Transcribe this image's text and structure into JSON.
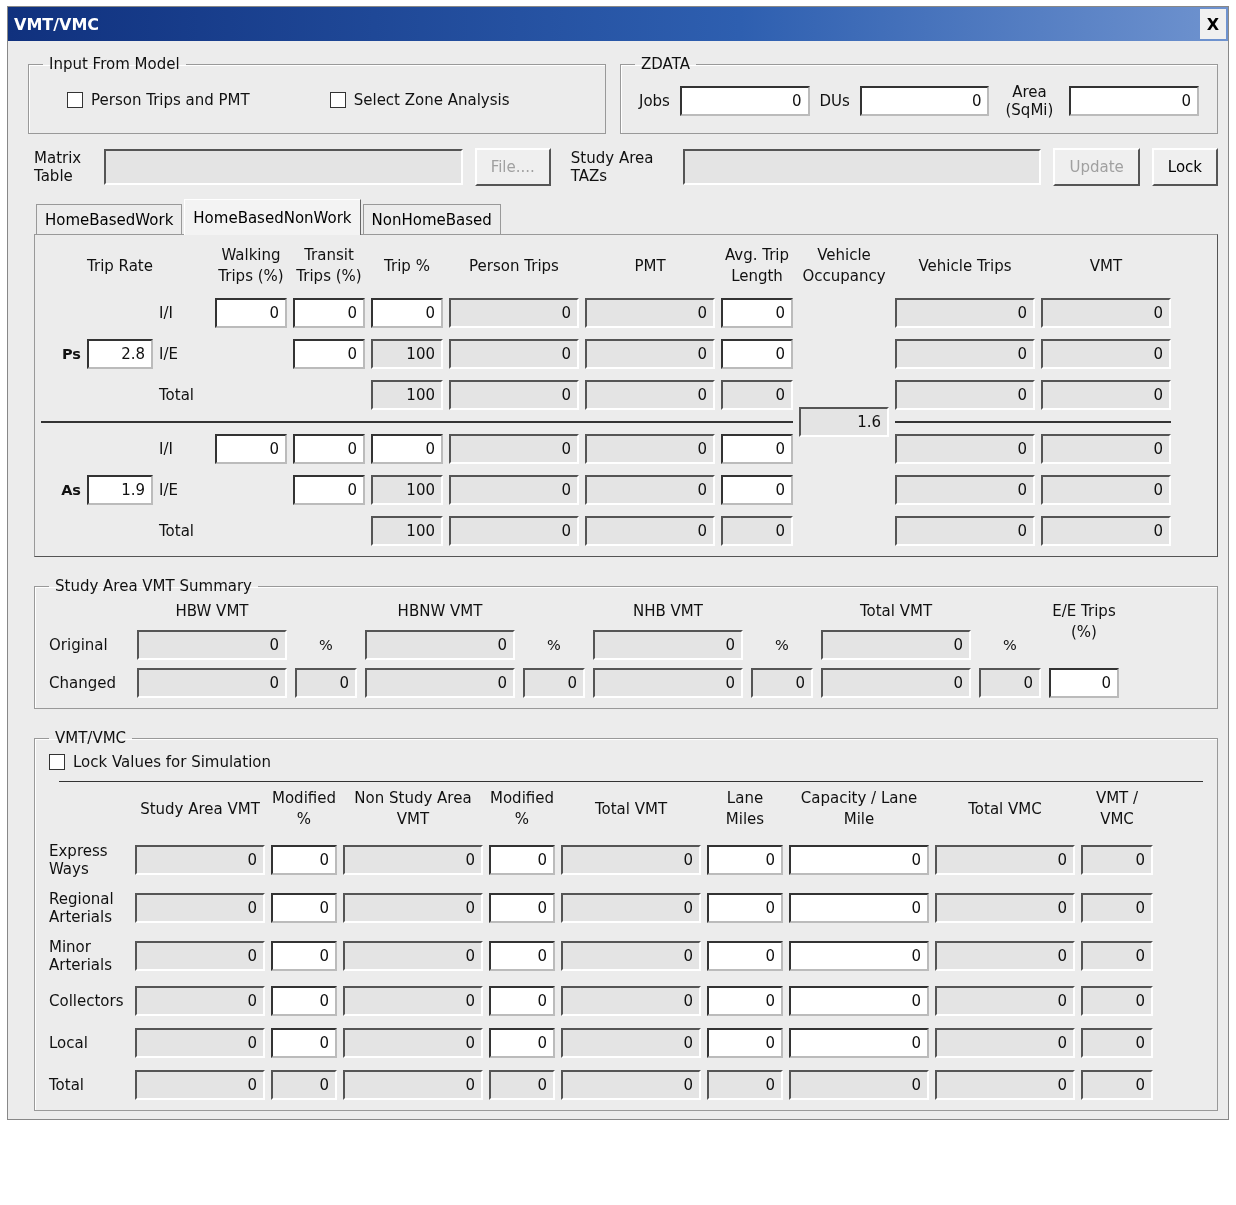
{
  "window": {
    "title": "VMT/VMC",
    "close": "X"
  },
  "input_from_model": {
    "title": "Input From Model",
    "checkboxes": [
      {
        "label": "Person Trips and PMT",
        "checked": false
      },
      {
        "label": "Select Zone Analysis",
        "checked": false
      }
    ]
  },
  "zdata": {
    "title": "ZDATA",
    "fields": [
      {
        "label": "Jobs",
        "value": "0"
      },
      {
        "label": "DUs",
        "value": "0"
      },
      {
        "label": "Area (SqMi)",
        "value": "0"
      }
    ]
  },
  "matrix": {
    "label": "Matrix Table",
    "button": {
      "label": "File....",
      "disabled": true
    }
  },
  "study_area": {
    "label": "Study Area TAZs",
    "buttons": [
      {
        "label": "Update",
        "disabled": true
      },
      {
        "label": "Lock",
        "disabled": false
      }
    ]
  },
  "tabs": [
    {
      "label": "HomeBasedWork",
      "selected": false
    },
    {
      "label": "HomeBasedNonWork",
      "selected": true
    },
    {
      "label": "NonHomeBased",
      "selected": false
    }
  ],
  "trips": {
    "columns": [
      "Trip Rate",
      "Walking Trips (%)",
      "Transit Trips (%)",
      "Trip %",
      "Person Trips",
      "PMT",
      "Avg. Trip Length",
      "Vehicle Occupancy",
      "Vehicle Trips",
      "VMT"
    ],
    "vehicle_occupancy": "1.6",
    "groups": [
      {
        "label": "Ps",
        "rate": "2.8",
        "rows": [
          {
            "label": "I/I",
            "cells": [
              {
                "kind": "input",
                "value": "0"
              },
              {
                "kind": "input",
                "value": "0"
              },
              {
                "kind": "input",
                "value": "0"
              },
              {
                "kind": "readonly",
                "value": "0"
              },
              {
                "kind": "readonly",
                "value": "0"
              },
              {
                "kind": "input",
                "value": "0"
              },
              {
                "kind": "readonly",
                "value": "0"
              },
              {
                "kind": "readonly",
                "value": "0"
              }
            ]
          },
          {
            "label": "I/E",
            "cells": [
              {
                "kind": "none"
              },
              {
                "kind": "input",
                "value": "0"
              },
              {
                "kind": "readonly",
                "value": "100"
              },
              {
                "kind": "readonly",
                "value": "0"
              },
              {
                "kind": "readonly",
                "value": "0"
              },
              {
                "kind": "input",
                "value": "0"
              },
              {
                "kind": "readonly",
                "value": "0"
              },
              {
                "kind": "readonly",
                "value": "0"
              }
            ]
          },
          {
            "label": "Total",
            "cells": [
              {
                "kind": "none"
              },
              {
                "kind": "none"
              },
              {
                "kind": "readonly",
                "value": "100"
              },
              {
                "kind": "readonly",
                "value": "0"
              },
              {
                "kind": "readonly",
                "value": "0"
              },
              {
                "kind": "readonly",
                "value": "0"
              },
              {
                "kind": "readonly",
                "value": "0"
              },
              {
                "kind": "readonly",
                "value": "0"
              }
            ]
          }
        ]
      },
      {
        "label": "As",
        "rate": "1.9",
        "rows": [
          {
            "label": "I/I",
            "cells": [
              {
                "kind": "input",
                "value": "0"
              },
              {
                "kind": "input",
                "value": "0"
              },
              {
                "kind": "input",
                "value": "0"
              },
              {
                "kind": "readonly",
                "value": "0"
              },
              {
                "kind": "readonly",
                "value": "0"
              },
              {
                "kind": "input",
                "value": "0"
              },
              {
                "kind": "readonly",
                "value": "0"
              },
              {
                "kind": "readonly",
                "value": "0"
              }
            ]
          },
          {
            "label": "I/E",
            "cells": [
              {
                "kind": "none"
              },
              {
                "kind": "input",
                "value": "0"
              },
              {
                "kind": "readonly",
                "value": "100"
              },
              {
                "kind": "readonly",
                "value": "0"
              },
              {
                "kind": "readonly",
                "value": "0"
              },
              {
                "kind": "input",
                "value": "0"
              },
              {
                "kind": "readonly",
                "value": "0"
              },
              {
                "kind": "readonly",
                "value": "0"
              }
            ]
          },
          {
            "label": "Total",
            "cells": [
              {
                "kind": "none"
              },
              {
                "kind": "none"
              },
              {
                "kind": "readonly",
                "value": "100"
              },
              {
                "kind": "readonly",
                "value": "0"
              },
              {
                "kind": "readonly",
                "value": "0"
              },
              {
                "kind": "readonly",
                "value": "0"
              },
              {
                "kind": "readonly",
                "value": "0"
              },
              {
                "kind": "readonly",
                "value": "0"
              }
            ]
          }
        ]
      }
    ]
  },
  "summary": {
    "title": "Study Area VMT Summary",
    "headers": [
      "HBW VMT",
      "HBNW VMT",
      "NHB VMT",
      "Total VMT"
    ],
    "original": {
      "label": "Original",
      "values": [
        "0",
        "0",
        "0",
        "0"
      ],
      "percent_signs": [
        "%",
        "%",
        "%",
        "%"
      ]
    },
    "changed": {
      "label": "Changed",
      "values": [
        "0",
        "0",
        "0",
        "0"
      ],
      "percents": [
        "0",
        "0",
        "0",
        "0"
      ]
    },
    "ee": {
      "label": "E/E Trips (%)",
      "value": "0"
    }
  },
  "vmt_vmc": {
    "title": "VMT/VMC",
    "lock": {
      "label": "Lock Values for Simulation",
      "checked": false
    },
    "columns": [
      "Study Area VMT",
      "Modified %",
      "Non Study Area VMT",
      "Modified %",
      "Total VMT",
      "Lane Miles",
      "Capacity / Lane Mile",
      "Total VMC",
      "VMT / VMC"
    ],
    "rows": [
      {
        "label": "Express Ways",
        "cells": [
          {
            "kind": "readonly",
            "value": "0"
          },
          {
            "kind": "input",
            "value": "0"
          },
          {
            "kind": "readonly",
            "value": "0"
          },
          {
            "kind": "input",
            "value": "0"
          },
          {
            "kind": "readonly",
            "value": "0"
          },
          {
            "kind": "input",
            "value": "0"
          },
          {
            "kind": "input",
            "value": "0"
          },
          {
            "kind": "readonly",
            "value": "0"
          },
          {
            "kind": "readonly",
            "value": "0"
          }
        ]
      },
      {
        "label": "Regional Arterials",
        "cells": [
          {
            "kind": "readonly",
            "value": "0"
          },
          {
            "kind": "input",
            "value": "0"
          },
          {
            "kind": "readonly",
            "value": "0"
          },
          {
            "kind": "input",
            "value": "0"
          },
          {
            "kind": "readonly",
            "value": "0"
          },
          {
            "kind": "input",
            "value": "0"
          },
          {
            "kind": "input",
            "value": "0"
          },
          {
            "kind": "readonly",
            "value": "0"
          },
          {
            "kind": "readonly",
            "value": "0"
          }
        ]
      },
      {
        "label": "Minor Arterials",
        "cells": [
          {
            "kind": "readonly",
            "value": "0"
          },
          {
            "kind": "input",
            "value": "0"
          },
          {
            "kind": "readonly",
            "value": "0"
          },
          {
            "kind": "input",
            "value": "0"
          },
          {
            "kind": "readonly",
            "value": "0"
          },
          {
            "kind": "input",
            "value": "0"
          },
          {
            "kind": "input",
            "value": "0"
          },
          {
            "kind": "readonly",
            "value": "0"
          },
          {
            "kind": "readonly",
            "value": "0"
          }
        ]
      },
      {
        "label": "Collectors",
        "cells": [
          {
            "kind": "readonly",
            "value": "0"
          },
          {
            "kind": "input",
            "value": "0"
          },
          {
            "kind": "readonly",
            "value": "0"
          },
          {
            "kind": "input",
            "value": "0"
          },
          {
            "kind": "readonly",
            "value": "0"
          },
          {
            "kind": "input",
            "value": "0"
          },
          {
            "kind": "input",
            "value": "0"
          },
          {
            "kind": "readonly",
            "value": "0"
          },
          {
            "kind": "readonly",
            "value": "0"
          }
        ]
      },
      {
        "label": "Local",
        "cells": [
          {
            "kind": "readonly",
            "value": "0"
          },
          {
            "kind": "input",
            "value": "0"
          },
          {
            "kind": "readonly",
            "value": "0"
          },
          {
            "kind": "input",
            "value": "0"
          },
          {
            "kind": "readonly",
            "value": "0"
          },
          {
            "kind": "input",
            "value": "0"
          },
          {
            "kind": "input",
            "value": "0"
          },
          {
            "kind": "readonly",
            "value": "0"
          },
          {
            "kind": "readonly",
            "value": "0"
          }
        ]
      },
      {
        "label": "Total",
        "cells": [
          {
            "kind": "readonly",
            "value": "0"
          },
          {
            "kind": "readonly",
            "value": "0"
          },
          {
            "kind": "readonly",
            "value": "0"
          },
          {
            "kind": "readonly",
            "value": "0"
          },
          {
            "kind": "readonly",
            "value": "0"
          },
          {
            "kind": "readonly",
            "value": "0"
          },
          {
            "kind": "readonly",
            "value": "0"
          },
          {
            "kind": "readonly",
            "value": "0"
          },
          {
            "kind": "readonly",
            "value": "0"
          }
        ]
      }
    ]
  }
}
